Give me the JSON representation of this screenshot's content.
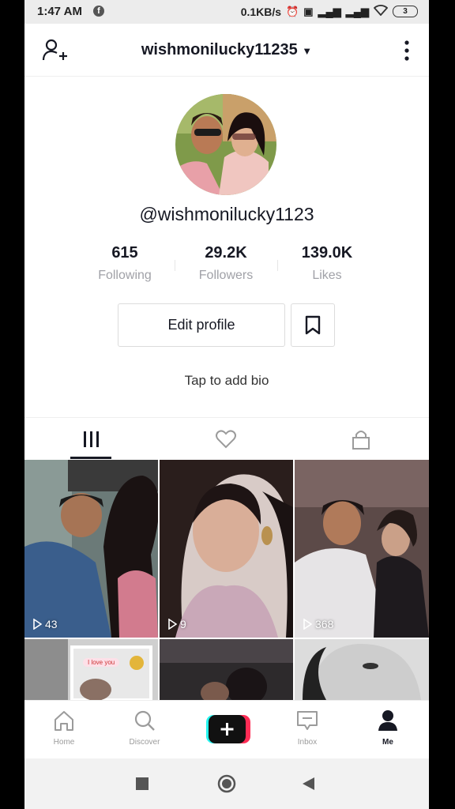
{
  "status": {
    "time": "1:47 AM",
    "net_speed": "0.1KB/s",
    "battery": "3"
  },
  "header": {
    "username": "wishmonilucky11235"
  },
  "profile": {
    "handle": "@wishmonilucky1123",
    "stats": [
      {
        "value": "615",
        "label": "Following"
      },
      {
        "value": "29.2K",
        "label": "Followers"
      },
      {
        "value": "139.0K",
        "label": "Likes"
      }
    ],
    "edit_label": "Edit profile",
    "bio_prompt": "Tap to add bio"
  },
  "videos": [
    {
      "views": "43"
    },
    {
      "views": "9"
    },
    {
      "views": "368"
    }
  ],
  "sticker_text": "I love you",
  "nav": [
    {
      "label": "Home"
    },
    {
      "label": "Discover"
    },
    {
      "label": ""
    },
    {
      "label": "Inbox"
    },
    {
      "label": "Me"
    }
  ]
}
